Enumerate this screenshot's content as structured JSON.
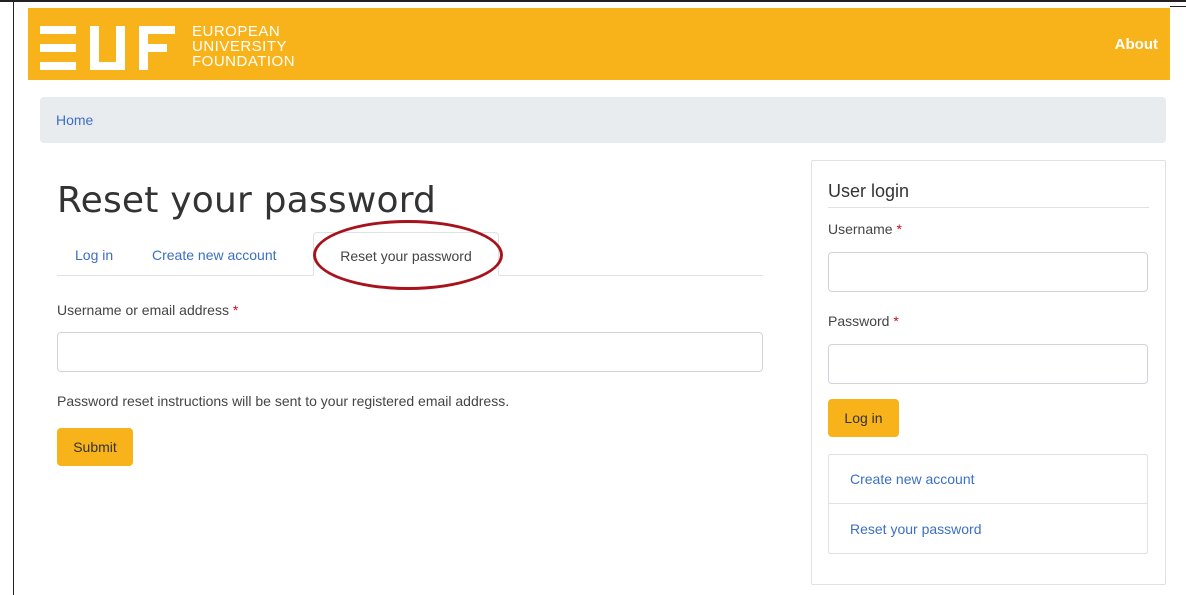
{
  "header": {
    "logo_mark": "EUF",
    "logo_lines": [
      "EUROPEAN",
      "UNIVERSITY",
      "FOUNDATION"
    ],
    "about_label": "About"
  },
  "breadcrumb": {
    "home": "Home"
  },
  "main": {
    "title": "Reset your password",
    "tabs": [
      {
        "label": "Log in",
        "active": false
      },
      {
        "label": "Create new account",
        "active": false
      },
      {
        "label": "Reset your password",
        "active": true
      }
    ],
    "username_label": "Username or email address",
    "required_marker": "*",
    "username_value": "",
    "help_text": "Password reset instructions will be sent to your registered email address.",
    "submit_label": "Submit"
  },
  "sidebar": {
    "title": "User login",
    "username_label": "Username",
    "password_label": "Password",
    "required_marker": "*",
    "username_value": "",
    "password_value": "",
    "login_label": "Log in",
    "links": [
      "Create new account",
      "Reset your password"
    ]
  },
  "colors": {
    "brand": "#f8b31a",
    "link": "#3b6fc4",
    "highlight": "#a8121b",
    "required": "#c1121f"
  }
}
